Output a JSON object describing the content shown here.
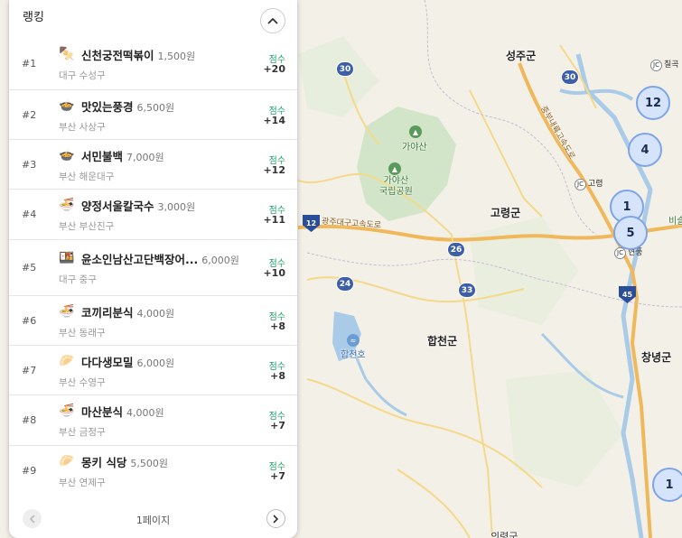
{
  "panel": {
    "title": "랭킹",
    "score_label": "점수",
    "page_label": "1페이지"
  },
  "ranking": [
    {
      "rank": "#1",
      "name": "신천궁전떡볶이",
      "price": "1,500원",
      "region": "대구 수성구",
      "score": "+20",
      "icon": "skewer-icon",
      "glyph": "🍢"
    },
    {
      "rank": "#2",
      "name": "맛있는풍경",
      "price": "6,500원",
      "region": "부산 사상구",
      "score": "+14",
      "icon": "bowl-icon",
      "glyph": "🍲"
    },
    {
      "rank": "#3",
      "name": "서민불백",
      "price": "7,000원",
      "region": "부산 해운대구",
      "score": "+12",
      "icon": "bowl-icon",
      "glyph": "🍲"
    },
    {
      "rank": "#4",
      "name": "양정서울칼국수",
      "price": "3,000원",
      "region": "부산 부산진구",
      "score": "+11",
      "icon": "noodle-icon",
      "glyph": "🍜"
    },
    {
      "rank": "#5",
      "name": "윤소인남산고단백장어...",
      "price": "6,000원",
      "region": "대구 중구",
      "score": "+10",
      "icon": "eel-icon",
      "glyph": "🍱"
    },
    {
      "rank": "#6",
      "name": "코끼리분식",
      "price": "4,000원",
      "region": "부산 동래구",
      "score": "+8",
      "icon": "noodle-icon",
      "glyph": "🍜"
    },
    {
      "rank": "#7",
      "name": "다다생모밀",
      "price": "6,000원",
      "region": "부산 수영구",
      "score": "+8",
      "icon": "dumpling-icon",
      "glyph": "🥟"
    },
    {
      "rank": "#8",
      "name": "마산분식",
      "price": "4,000원",
      "region": "부산 금정구",
      "score": "+7",
      "icon": "noodle-icon",
      "glyph": "🍜"
    },
    {
      "rank": "#9",
      "name": "몽키 식당",
      "price": "5,500원",
      "region": "부산 연제구",
      "score": "+7",
      "icon": "dumpling-icon",
      "glyph": "🥟"
    }
  ],
  "map": {
    "labels": {
      "seongju": "성주군",
      "goryeong": "고령군",
      "hapcheon": "합천군",
      "changnyeong": "창녕군",
      "gayasan": "가야산",
      "gayasan_park": "가야산\n국립공원",
      "hapcheonho": "합천호",
      "expressway": "광주대구고속도로",
      "expressway2": "중부내륙고속도로",
      "goryeong_jc": "고령",
      "chilgok": "칠곡",
      "hyeonpung": "현풍",
      "biseul": "비슬",
      "uiryeong": "의령군"
    },
    "routes": [
      "30",
      "30",
      "12",
      "26",
      "24",
      "33",
      "45"
    ],
    "clusters": [
      "12",
      "4",
      "1",
      "5",
      "1"
    ]
  },
  "colors": {
    "accent": "#22a06b",
    "cluster_fill": "#d6e4fb",
    "cluster_border": "#7ea4e8"
  }
}
